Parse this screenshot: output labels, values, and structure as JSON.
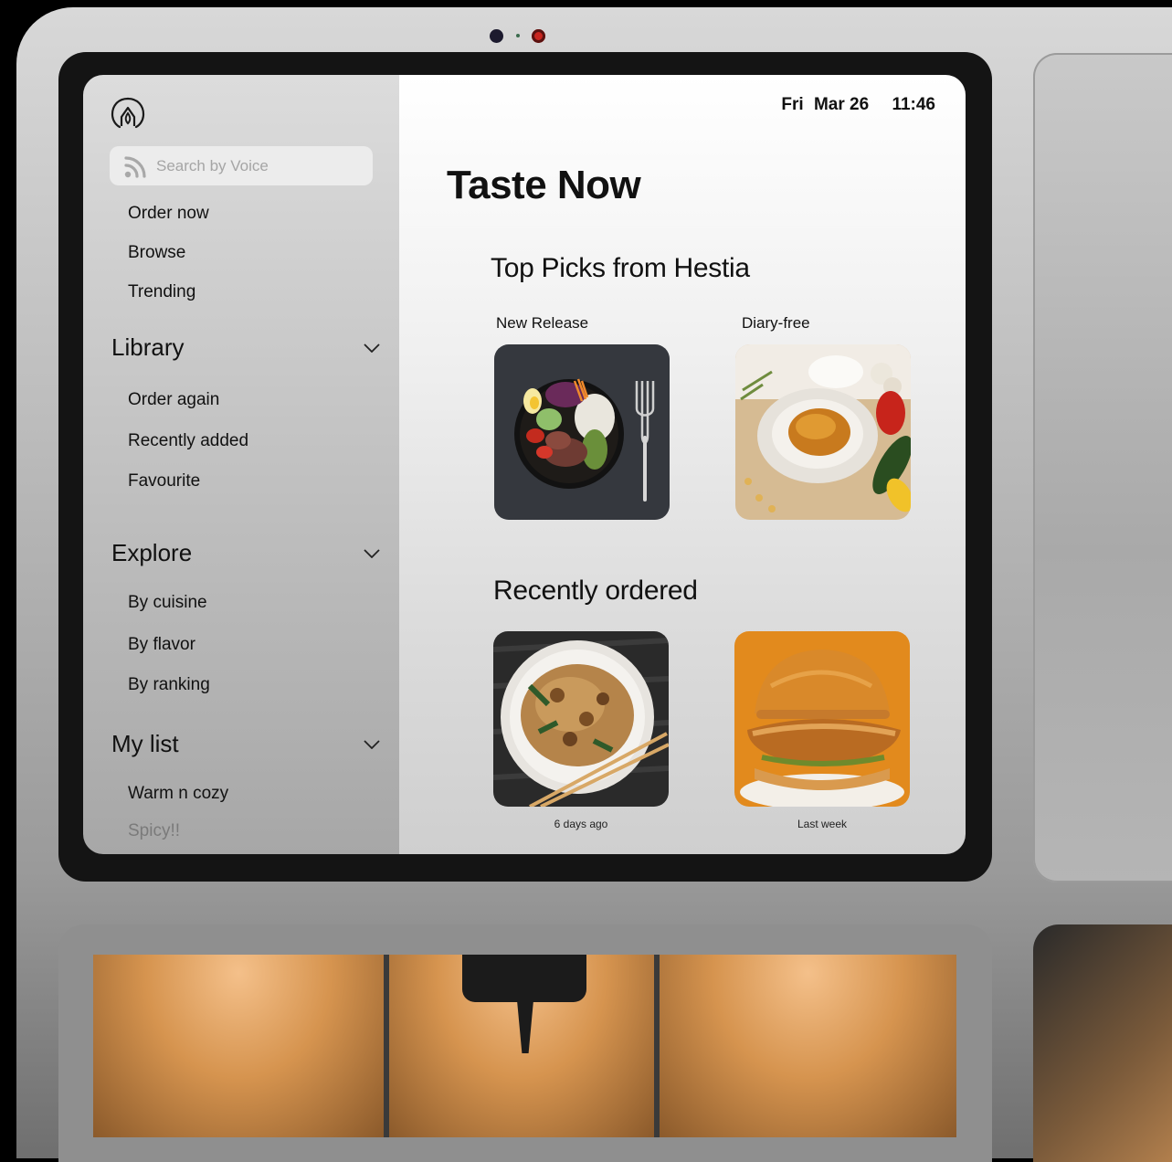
{
  "search": {
    "placeholder": "Search by Voice"
  },
  "sidebar": {
    "top_items": [
      {
        "label": "Order now"
      },
      {
        "label": "Browse"
      },
      {
        "label": "Trending"
      }
    ],
    "sections": [
      {
        "title": "Library",
        "items": [
          "Order again",
          "Recently added",
          "Favourite"
        ]
      },
      {
        "title": "Explore",
        "items": [
          "By cuisine",
          "By flavor",
          "By ranking"
        ]
      },
      {
        "title": "My list",
        "items": [
          "Warm n cozy",
          "Spicy!!"
        ]
      }
    ]
  },
  "header": {
    "day": "Fri",
    "date": "Mar 26",
    "time": "11:46"
  },
  "main": {
    "title": "Taste Now",
    "top_picks": {
      "heading": "Top Picks from Hestia",
      "cards": [
        {
          "label": "New Release"
        },
        {
          "label": "Diary-free"
        }
      ]
    },
    "recent": {
      "heading": "Recently ordered",
      "cards": [
        {
          "caption": "6 days ago"
        },
        {
          "caption": "Last week"
        }
      ]
    }
  },
  "colors": {
    "screen_bg": "#f2f2f2",
    "sidebar_bg": "#c8c8c8",
    "text": "#111111",
    "placeholder": "#a5a5a5",
    "accent_orange": "#e28a1d"
  },
  "icons": [
    "hestia-logo-icon",
    "voice-icon",
    "chevron-down-icon"
  ]
}
